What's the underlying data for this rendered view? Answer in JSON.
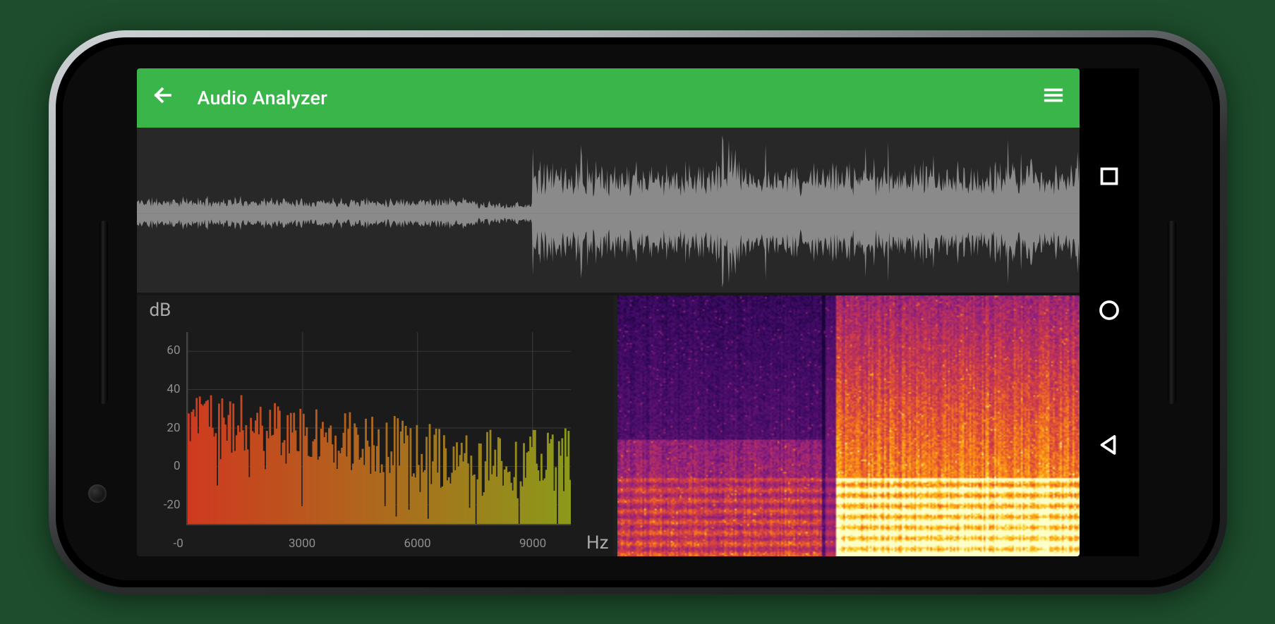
{
  "appbar": {
    "title": "Audio Analyzer",
    "back_icon": "arrow-left",
    "menu_icon": "hamburger"
  },
  "navbar": {
    "buttons": [
      "square",
      "circle",
      "triangle"
    ]
  },
  "waveform_panel": {},
  "chart_data": {
    "type": "bar",
    "title": "",
    "xlabel": "Hz",
    "ylabel": "dB",
    "x_ticks": [
      "-0",
      "3000",
      "6000",
      "9000"
    ],
    "y_ticks": [
      "60",
      "40",
      "20",
      "0",
      "-20"
    ],
    "xlim": [
      0,
      10000
    ],
    "ylim": [
      -30,
      70
    ],
    "bar_color_low": "#cf3a1f",
    "bar_color_high": "#8b9a1b",
    "approx_envelope_db": [
      {
        "hz": 0,
        "db": 48
      },
      {
        "hz": 500,
        "db": 40
      },
      {
        "hz": 1000,
        "db": 38
      },
      {
        "hz": 1700,
        "db": 44
      },
      {
        "hz": 2500,
        "db": 35
      },
      {
        "hz": 3500,
        "db": 32
      },
      {
        "hz": 4500,
        "db": 30
      },
      {
        "hz": 5500,
        "db": 28
      },
      {
        "hz": 6500,
        "db": 22
      },
      {
        "hz": 7500,
        "db": 20
      },
      {
        "hz": 8500,
        "db": 18
      },
      {
        "hz": 9500,
        "db": 20
      }
    ]
  },
  "spectrogram_panel": {
    "colormap": "inferno"
  },
  "colors": {
    "accent": "#3ab54a",
    "screen_bg": "#1f1f1f",
    "panel_bg": "#282828",
    "wave": "#8a8a8a",
    "grid": "#3a3a3a",
    "text_muted": "#ababab"
  }
}
